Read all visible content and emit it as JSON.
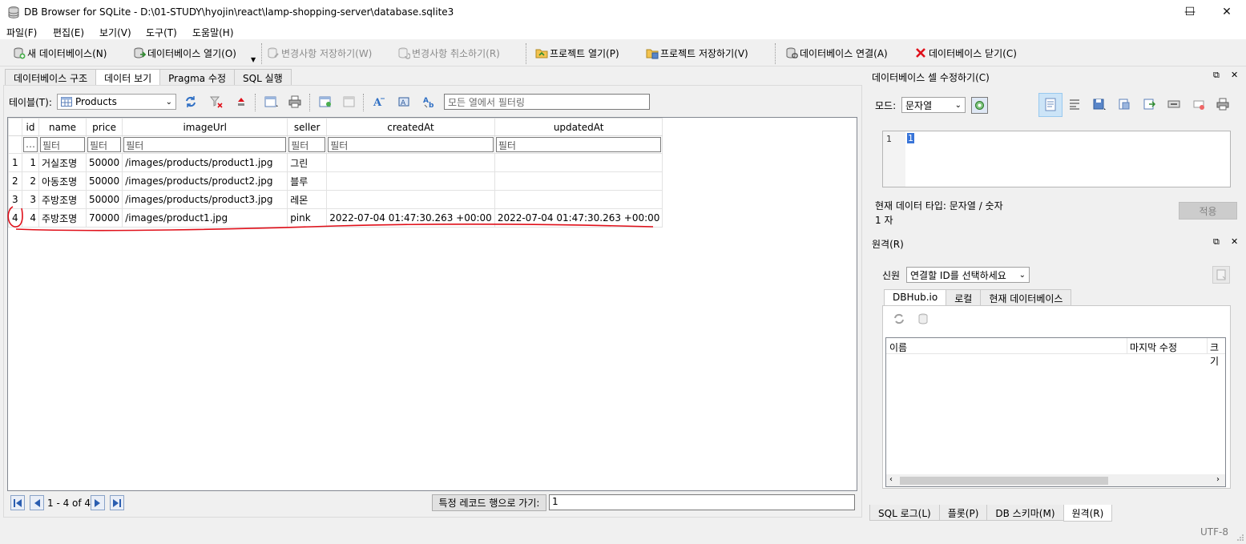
{
  "window": {
    "title": "DB Browser for SQLite - D:\\01-STUDY\\hyojin\\react\\lamp-shopping-server\\database.sqlite3",
    "minimize": "—",
    "maximize": "☐",
    "close": "✕"
  },
  "menu": [
    "파일(F)",
    "편집(E)",
    "보기(V)",
    "도구(T)",
    "도움말(H)"
  ],
  "toolbar": {
    "new_db": "새 데이터베이스(N)",
    "open_db": "데이터베이스 열기(O)",
    "write_changes": "변경사항 저장하기(W)",
    "revert_changes": "변경사항 취소하기(R)",
    "open_project": "프로젝트 열기(P)",
    "save_project": "프로젝트 저장하기(V)",
    "attach_db": "데이터베이스 연결(A)",
    "close_db": "데이터베이스 닫기(C)"
  },
  "tabs": [
    "데이터베이스 구조",
    "데이터 보기",
    "Pragma 수정",
    "SQL 실행"
  ],
  "browse": {
    "table_label": "테이블(T):",
    "table_selected": "Products",
    "filter_all_placeholder": "모든 열에서 필터링",
    "columns": [
      "id",
      "name",
      "price",
      "imageUrl",
      "seller",
      "createdAt",
      "updatedAt"
    ],
    "filter_dots": "…",
    "filter_placeholder": "필터",
    "rows": [
      {
        "rownum": "1",
        "id": "1",
        "name": "거실조명",
        "price": "50000",
        "imageUrl": "/images/products/product1.jpg",
        "seller": "그린",
        "createdAt": "",
        "updatedAt": ""
      },
      {
        "rownum": "2",
        "id": "2",
        "name": "아동조명",
        "price": "50000",
        "imageUrl": "/images/products/product2.jpg",
        "seller": "블루",
        "createdAt": "",
        "updatedAt": ""
      },
      {
        "rownum": "3",
        "id": "3",
        "name": "주방조명",
        "price": "50000",
        "imageUrl": "/images/products/product3.jpg",
        "seller": "레몬",
        "createdAt": "",
        "updatedAt": ""
      },
      {
        "rownum": "4",
        "id": "4",
        "name": "주방조명",
        "price": "70000",
        "imageUrl": "/images/product1.jpg",
        "seller": "pink",
        "createdAt": "2022-07-04 01:47:30.263 +00:00",
        "updatedAt": "2022-07-04 01:47:30.263 +00:00"
      }
    ],
    "record_count": "1 - 4 of 4",
    "goto_label": "특정 레코드 행으로 가기:",
    "goto_value": "1"
  },
  "edit_cell": {
    "title": "데이터베이스 셀 수정하기(C)",
    "mode_label": "모드:",
    "mode_value": "문자열",
    "line_number": "1",
    "editor_value": "1",
    "data_type": "현재 데이터 타입: 문자열 / 숫자",
    "size": "1 자",
    "apply": "적용"
  },
  "remote": {
    "title": "원격(R)",
    "identity_label": "신원",
    "identity_value": "연결할 ID를 선택하세요",
    "tabs": [
      "DBHub.io",
      "로컬",
      "현재 데이터베이스"
    ],
    "columns": [
      "이름",
      "마지막 수정",
      "크기"
    ]
  },
  "bottom_tabs": [
    "SQL 로그(L)",
    "플롯(P)",
    "DB 스키마(M)",
    "원격(R)"
  ],
  "status": {
    "encoding": "UTF-8"
  },
  "colors": {
    "annotation": "#e0101a",
    "nav_blue": "#2a5db0",
    "selected_tool": "#cce4f7"
  }
}
